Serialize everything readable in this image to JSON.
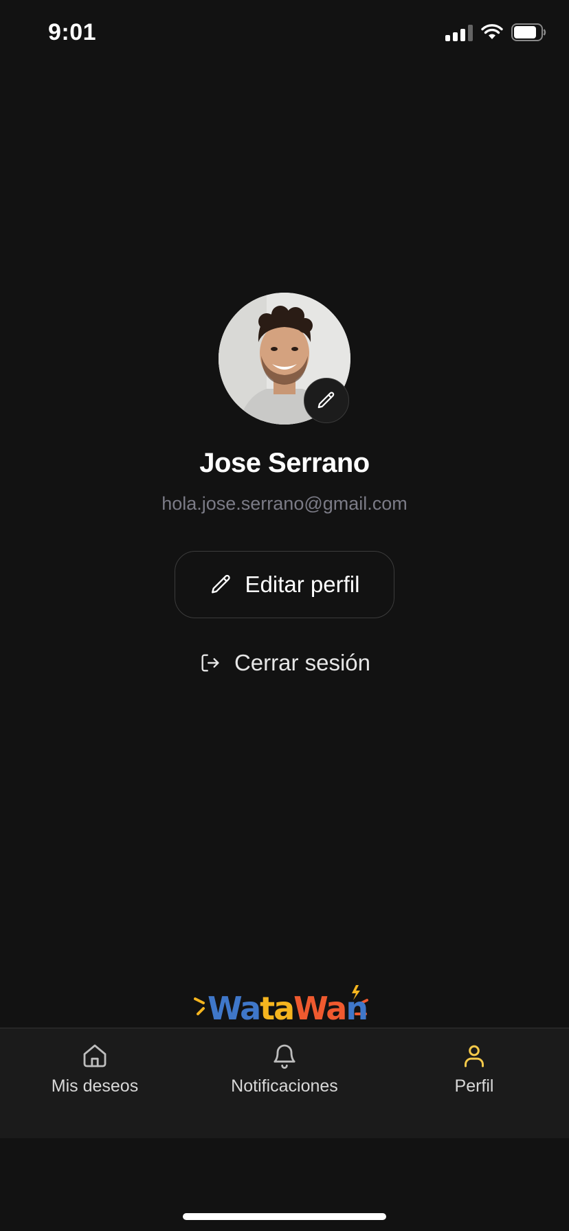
{
  "status_bar": {
    "time": "9:01"
  },
  "profile": {
    "name": "Jose Serrano",
    "email": "hola.jose.serrano@gmail.com",
    "avatar_icon": "user-photo"
  },
  "actions": {
    "edit_profile_label": "Editar perfil",
    "logout_label": "Cerrar sesión"
  },
  "brand": {
    "logo_text": "WataWan"
  },
  "tabs": [
    {
      "label": "Mis deseos",
      "icon": "home-icon",
      "active": false
    },
    {
      "label": "Notificaciones",
      "icon": "bell-icon",
      "active": false
    },
    {
      "label": "Perfil",
      "icon": "user-icon",
      "active": true
    }
  ],
  "colors": {
    "background": "#121212",
    "tab_bar": "#1b1b1b",
    "active_tab_icon": "#f5c94a",
    "email": "#7b7b86",
    "logo_blue": "#3f77c9",
    "logo_yellow": "#f5b51f",
    "logo_orange": "#ef5a2f"
  }
}
